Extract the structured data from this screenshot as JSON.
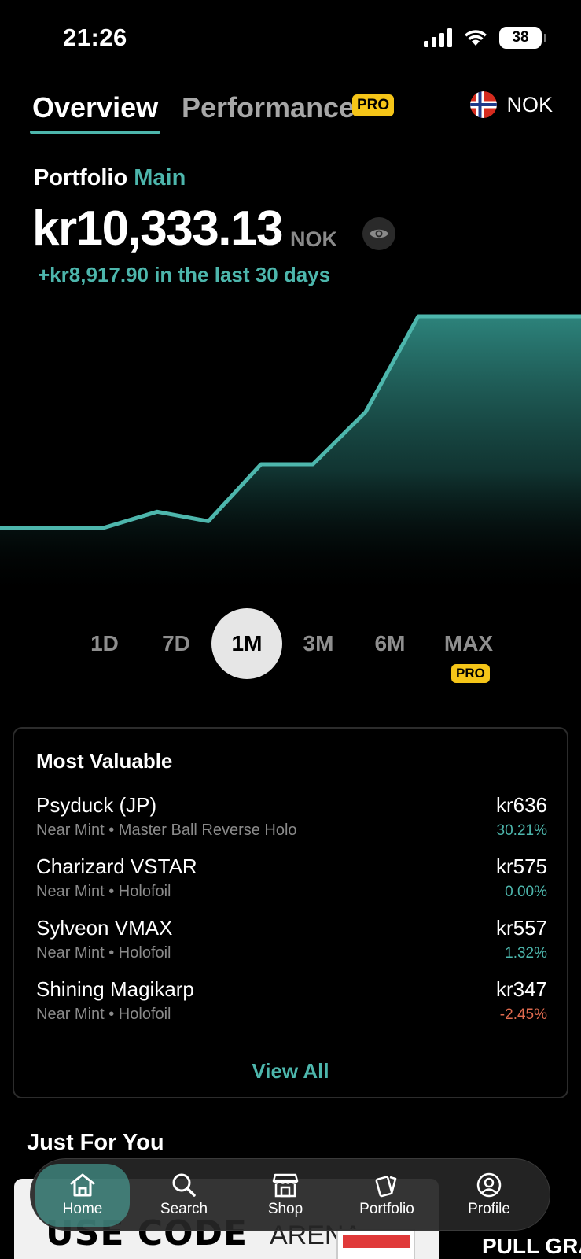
{
  "status_bar": {
    "time": "21:26",
    "battery": "38"
  },
  "tabs": {
    "overview": "Overview",
    "performance": "Performance",
    "performance_badge": "PRO",
    "currency_code": "NOK"
  },
  "portfolio": {
    "label": "Portfolio",
    "name": "Main",
    "balance": "kr10,333.13",
    "balance_currency": "NOK",
    "change_text": "+kr8,917.90 in the last 30 days"
  },
  "chart_data": {
    "type": "area",
    "x": [
      0,
      1,
      2,
      3,
      4,
      5,
      6,
      7,
      8,
      9,
      10,
      11
    ],
    "values": [
      1400,
      1400,
      1400,
      2100,
      1700,
      4100,
      4100,
      6300,
      10333,
      10333,
      10333,
      10333
    ],
    "color": "#4db6ac",
    "grid": false,
    "title": "",
    "xlabel": "",
    "ylabel": ""
  },
  "ranges": {
    "items": [
      {
        "label": "1D",
        "active": false
      },
      {
        "label": "7D",
        "active": false
      },
      {
        "label": "1M",
        "active": true
      },
      {
        "label": "3M",
        "active": false
      },
      {
        "label": "6M",
        "active": false
      },
      {
        "label": "MAX",
        "active": false
      }
    ],
    "max_badge": "PRO"
  },
  "most_valuable": {
    "title": "Most Valuable",
    "items": [
      {
        "name": "Psyduck (JP)",
        "detail": "Near Mint • Master Ball Reverse Holo",
        "price": "kr636",
        "change": "30.21%",
        "trend": "up"
      },
      {
        "name": "Charizard VSTAR",
        "detail": "Near Mint • Holofoil",
        "price": "kr575",
        "change": "0.00%",
        "trend": "flat"
      },
      {
        "name": "Sylveon VMAX",
        "detail": "Near Mint • Holofoil",
        "price": "kr557",
        "change": "1.32%",
        "trend": "up"
      },
      {
        "name": "Shining Magikarp",
        "detail": "Near Mint • Holofoil",
        "price": "kr347",
        "change": "-2.45%",
        "trend": "down"
      }
    ],
    "view_all": "View All"
  },
  "just_for_you": {
    "title": "Just For You",
    "promo_code_text": "USE CODE",
    "promo_brand": "ARENA",
    "promo_right_text": "PULL GRA"
  },
  "bottom_nav": {
    "items": [
      {
        "label": "Home",
        "icon": "home-icon",
        "active": true
      },
      {
        "label": "Search",
        "icon": "search-icon",
        "active": false
      },
      {
        "label": "Shop",
        "icon": "shop-icon",
        "active": false
      },
      {
        "label": "Portfolio",
        "icon": "cards-icon",
        "active": false
      },
      {
        "label": "Profile",
        "icon": "profile-icon",
        "active": false
      }
    ]
  },
  "colors": {
    "accent": "#4db6ac",
    "pro": "#f5c518",
    "negative": "#e06b4f"
  }
}
